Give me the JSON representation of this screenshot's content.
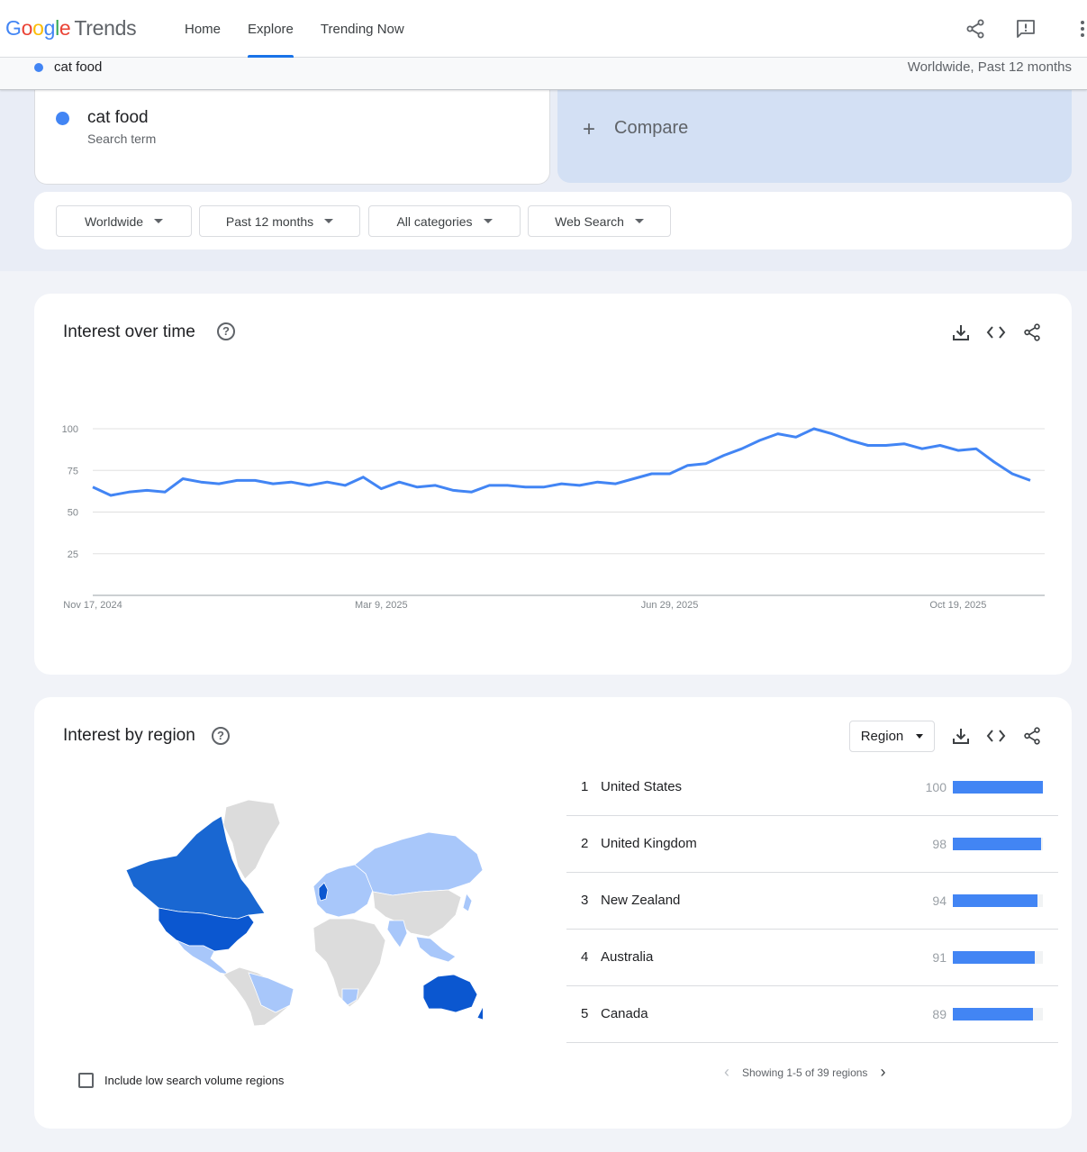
{
  "header": {
    "logo_google": [
      "G",
      "o",
      "o",
      "g",
      "l",
      "e"
    ],
    "logo_trends": "Trends",
    "nav": [
      {
        "label": "Home",
        "active": false
      },
      {
        "label": "Explore",
        "active": true
      },
      {
        "label": "Trending Now",
        "active": false
      }
    ],
    "icons": [
      "share-icon",
      "feedback-icon",
      "more-vert-icon"
    ]
  },
  "subbar": {
    "term": "cat food",
    "scope": "Worldwide, Past 12 months"
  },
  "search_term": {
    "name": "cat food",
    "type": "Search term",
    "color": "#4285f4"
  },
  "compare": {
    "plus": "+",
    "label": "Compare"
  },
  "filters": [
    {
      "label": "Worldwide"
    },
    {
      "label": "Past 12 months"
    },
    {
      "label": "All categories"
    },
    {
      "label": "Web Search"
    }
  ],
  "interest_over_time": {
    "title": "Interest over time",
    "help": "?",
    "icons": [
      "download-icon",
      "embed-icon",
      "share-icon"
    ]
  },
  "chart_data": {
    "type": "line",
    "x_tick_labels": [
      "Nov 17, 2024",
      "Mar 9, 2025",
      "Jun 29, 2025",
      "Oct 19, 2025"
    ],
    "ylim": [
      0,
      100
    ],
    "y_ticks": [
      25,
      50,
      75,
      100
    ],
    "grid": true,
    "series": [
      {
        "color": "#4285f4",
        "values": [
          65,
          60,
          62,
          63,
          62,
          70,
          68,
          67,
          69,
          69,
          67,
          68,
          66,
          68,
          66,
          71,
          64,
          68,
          65,
          66,
          63,
          62,
          66,
          66,
          65,
          65,
          67,
          66,
          68,
          67,
          70,
          73,
          73,
          78,
          79,
          84,
          88,
          93,
          97,
          95,
          100,
          97,
          93,
          90,
          90,
          91,
          88,
          90,
          87,
          88,
          80,
          73,
          69
        ]
      }
    ]
  },
  "interest_by_region": {
    "title": "Interest by region",
    "help": "?",
    "selector": "Region",
    "icons": [
      "download-icon",
      "embed-icon",
      "share-icon"
    ],
    "map_colors": {
      "high": "#1a73e8",
      "mid": "#a8c7fa",
      "none": "#dcdcdc"
    },
    "rows": [
      {
        "rank": "1",
        "name": "United States",
        "value": 100
      },
      {
        "rank": "2",
        "name": "United Kingdom",
        "value": 98
      },
      {
        "rank": "3",
        "name": "New Zealand",
        "value": 94
      },
      {
        "rank": "4",
        "name": "Australia",
        "value": 91
      },
      {
        "rank": "5",
        "name": "Canada",
        "value": 89
      }
    ],
    "pager": "Showing 1-5 of 39 regions",
    "checkbox_label": "Include low search volume regions"
  }
}
